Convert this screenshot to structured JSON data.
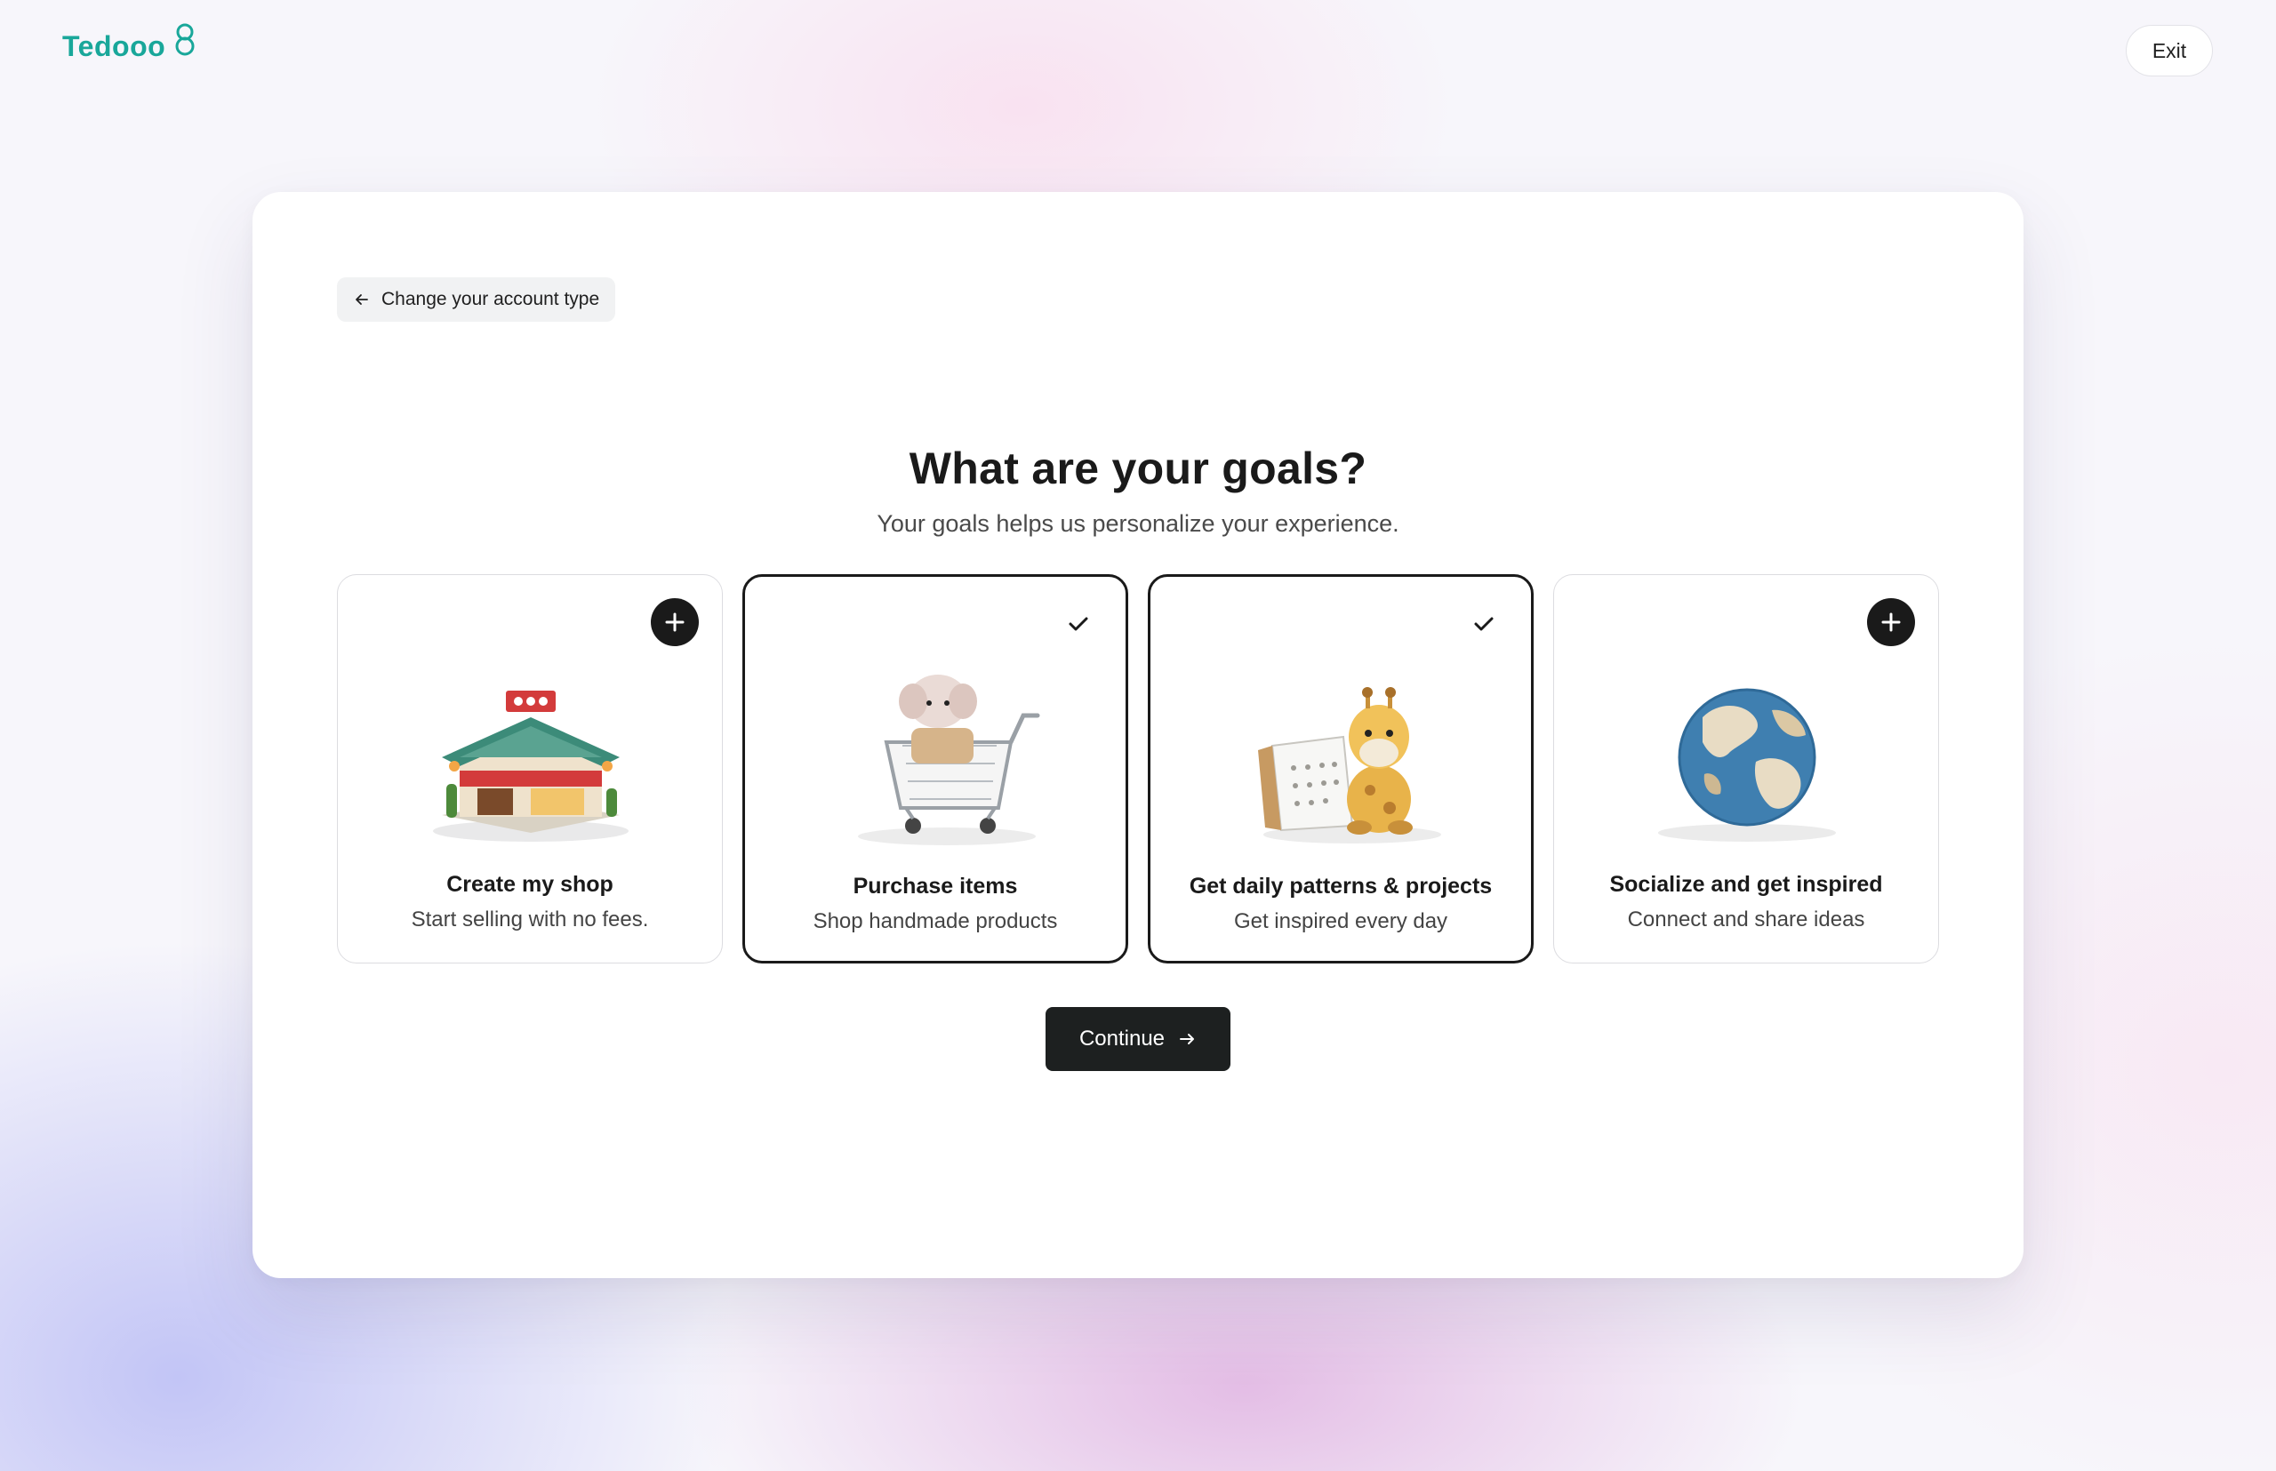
{
  "brand": {
    "name": "Tedooo",
    "color": "#19a79a"
  },
  "header": {
    "exit_label": "Exit"
  },
  "back": {
    "label": "Change your account type",
    "icon": "arrow-left-icon"
  },
  "page": {
    "title": "What are your goals?",
    "subtitle": "Your goals helps us personalize your experience."
  },
  "goals": [
    {
      "title": "Create my shop",
      "description": "Start selling with no fees.",
      "selected": false,
      "icon": "plus-icon",
      "illustration": "shop-illustration"
    },
    {
      "title": "Purchase items",
      "description": "Shop handmade products",
      "selected": true,
      "icon": "check-icon",
      "illustration": "shopping-cart-illustration"
    },
    {
      "title": "Get daily patterns & projects",
      "description": "Get inspired every day",
      "selected": true,
      "icon": "check-icon",
      "illustration": "giraffe-calendar-illustration"
    },
    {
      "title": "Socialize and get inspired",
      "description": "Connect and share ideas",
      "selected": false,
      "icon": "plus-icon",
      "illustration": "globe-illustration"
    }
  ],
  "actions": {
    "continue_label": "Continue",
    "continue_icon": "arrow-right-icon"
  },
  "colors": {
    "primary": "#1d2020",
    "selected_border": "#1a1a1a"
  }
}
